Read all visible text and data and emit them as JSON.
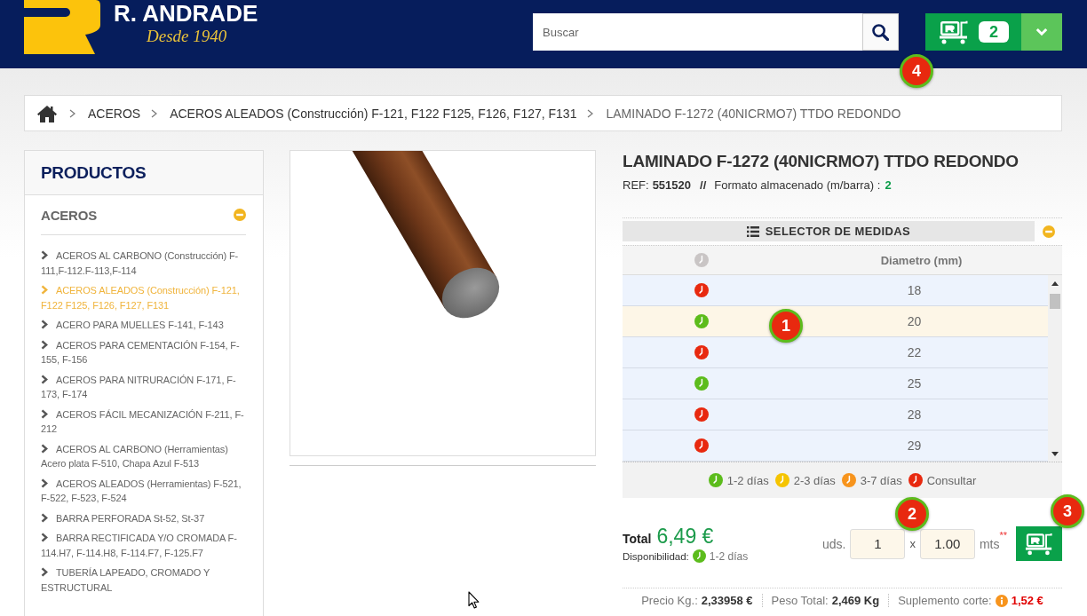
{
  "header": {
    "logo": {
      "name": "R. ANDRADE",
      "tagline": "Desde 1940"
    },
    "search": {
      "placeholder": "Buscar"
    },
    "cart": {
      "count": "2",
      "marker": "4"
    }
  },
  "breadcrumb": [
    {
      "label": "ACEROS",
      "current": false
    },
    {
      "label": "ACEROS ALEADOS (Construcción) F-121, F122 F125, F126, F127, F131",
      "current": false
    },
    {
      "label": "LAMINADO F-1272 (40NICRMO7) TTDO REDONDO",
      "current": true
    }
  ],
  "sidebar": {
    "title": "PRODUCTOS",
    "section": {
      "label": "ACEROS",
      "expanded": true,
      "items": [
        {
          "label": "ACEROS AL CARBONO (Construcción) F-111,F-112.F-113,F-114",
          "selected": false
        },
        {
          "label": "ACEROS ALEADOS (Construcción) F-121, F122 F125, F126, F127, F131",
          "selected": true
        },
        {
          "label": "ACERO PARA MUELLES F-141, F-143",
          "selected": false
        },
        {
          "label": "ACEROS PARA CEMENTACIÓN F-154, F-155, F-156",
          "selected": false
        },
        {
          "label": "ACEROS PARA NITRURACIÓN F-171, F-173, F-174",
          "selected": false
        },
        {
          "label": "ACEROS FÁCIL MECANIZACIÓN F-211, F-212",
          "selected": false
        },
        {
          "label": "ACEROS AL CARBONO (Herramientas) Acero plata F-510, Chapa Azul F-513",
          "selected": false
        },
        {
          "label": "ACEROS ALEADOS (Herramientas) F-521, F-522, F-523, F-524",
          "selected": false
        },
        {
          "label": "BARRA PERFORADA St-52, St-37",
          "selected": false
        },
        {
          "label": "BARRA RECTIFICADA Y/O CROMADA F-114.H7, F-114.H8, F-114.F7, F-125.F7",
          "selected": false
        },
        {
          "label": "TUBERÍA LAPEADO, CROMADO Y ESTRUCTURAL",
          "selected": false
        }
      ]
    }
  },
  "product": {
    "title": "LAMINADO F-1272 (40NICRMO7) TTDO REDONDO",
    "ref_label": "REF:",
    "ref": "551520",
    "separator": "//",
    "format_label": "Formato almacenado (m/barra) :",
    "format_value": "2",
    "selector": {
      "title": "SELECTOR DE MEDIDAS",
      "expanded": true,
      "column": "Diametro (mm)",
      "marker": "1",
      "rows": [
        {
          "value": "18",
          "color": "#e8290f",
          "selected": false
        },
        {
          "value": "20",
          "color": "#5cbc1c",
          "selected": true
        },
        {
          "value": "22",
          "color": "#e8290f",
          "selected": false
        },
        {
          "value": "25",
          "color": "#5cbc1c",
          "selected": false
        },
        {
          "value": "28",
          "color": "#e8290f",
          "selected": false
        },
        {
          "value": "29",
          "color": "#e8290f",
          "selected": false
        }
      ],
      "legend": [
        {
          "label": "1-2 días",
          "color": "#5cbc1c"
        },
        {
          "label": "2-3 días",
          "color": "#f5c400"
        },
        {
          "label": "3-7 días",
          "color": "#f7941d"
        },
        {
          "label": "Consultar",
          "color": "#e8290f"
        }
      ]
    },
    "order": {
      "total": {
        "label": "Total",
        "value": "6,49 €"
      },
      "availability": {
        "label": "Disponibilidad:",
        "color": "#5cbc1c",
        "text": "1-2 días"
      },
      "quantity": {
        "units_label": "uds.",
        "units": "1",
        "times": "x",
        "length": "1.00",
        "length_unit": "mts",
        "note_mark": "**",
        "marker": "2"
      },
      "add_to_cart": {
        "marker": "3"
      }
    },
    "summary": [
      {
        "kind": "metric",
        "label": "Precio Kg.:",
        "value": "2,33958 €"
      },
      {
        "kind": "metric",
        "label": "Peso Total:",
        "value": "2,469 Kg"
      },
      {
        "kind": "surcharge",
        "label": "Suplemento corte:",
        "value": "1,52 €"
      }
    ]
  }
}
